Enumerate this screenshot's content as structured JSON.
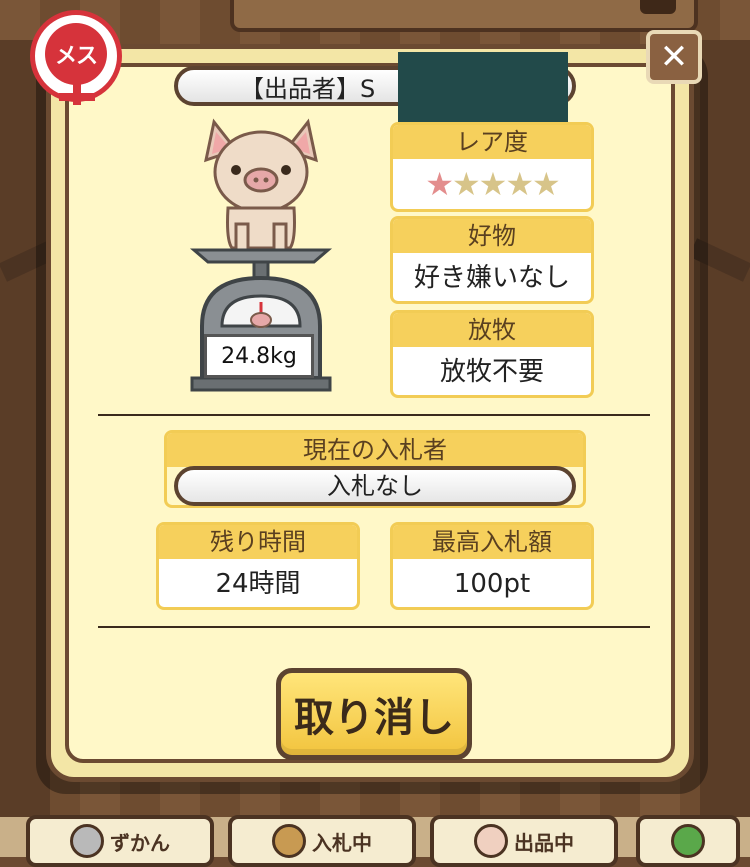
{
  "gender_badge": {
    "label": "メス",
    "color": "#d6333b"
  },
  "close": {
    "label": "✕"
  },
  "exhibitor": {
    "label": "【出品者】S"
  },
  "pig": {
    "weight": "24.8kg"
  },
  "rarity": {
    "label": "レア度",
    "stars_total": 5,
    "stars_filled": 1,
    "star_filled": "★",
    "star_empty": "★"
  },
  "favorite": {
    "label": "好物",
    "value": "好き嫌いなし"
  },
  "grazing": {
    "label": "放牧",
    "value": "放牧不要"
  },
  "current_bidder": {
    "label": "現在の入札者",
    "value": "入札なし"
  },
  "time_left": {
    "label": "残り時間",
    "value": "24時間"
  },
  "highest_bid": {
    "label": "最高入札額",
    "value": "100pt"
  },
  "cancel_button": {
    "label": "取り消し"
  },
  "bottom_nav": {
    "items": [
      {
        "label": "ずかん"
      },
      {
        "label": "入札中"
      },
      {
        "label": "出品中"
      }
    ]
  },
  "colors": {
    "panel": "#fff8c8",
    "card_head": "#f6d05c",
    "border": "#6b4a31",
    "button": "#f2c43e"
  }
}
